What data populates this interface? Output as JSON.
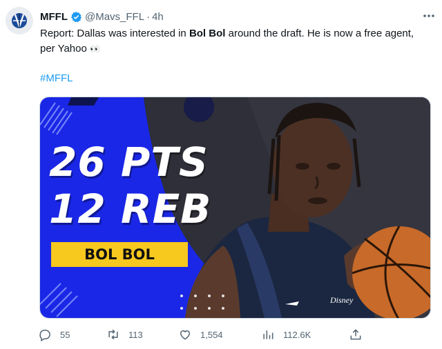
{
  "tweet": {
    "author_name": "MFFL",
    "handle": "@Mavs_FFL",
    "separator": "·",
    "time": "4h",
    "text_before": "Report: Dallas was interested in ",
    "text_bold1": "Bol Bol",
    "text_middle": " around the draft. He is now a free agent, per Yahoo ",
    "text_emoji": "👀",
    "hashtag": "#MFFL"
  },
  "media": {
    "stat1": "26 PTS",
    "stat2": "12 REB",
    "player_name": "BOL BOL",
    "background_color": "#1a27e6",
    "badge_color": "#f7c81e",
    "jersey_text": "Disney"
  },
  "actions": {
    "replies": "55",
    "retweets": "113",
    "likes": "1,554",
    "views": "112.6K"
  },
  "colors": {
    "accent": "#1d9bf0",
    "secondary_text": "#536471"
  },
  "icons": [
    "verified-icon",
    "more-icon",
    "reply-icon",
    "retweet-icon",
    "like-icon",
    "views-icon",
    "share-icon"
  ]
}
